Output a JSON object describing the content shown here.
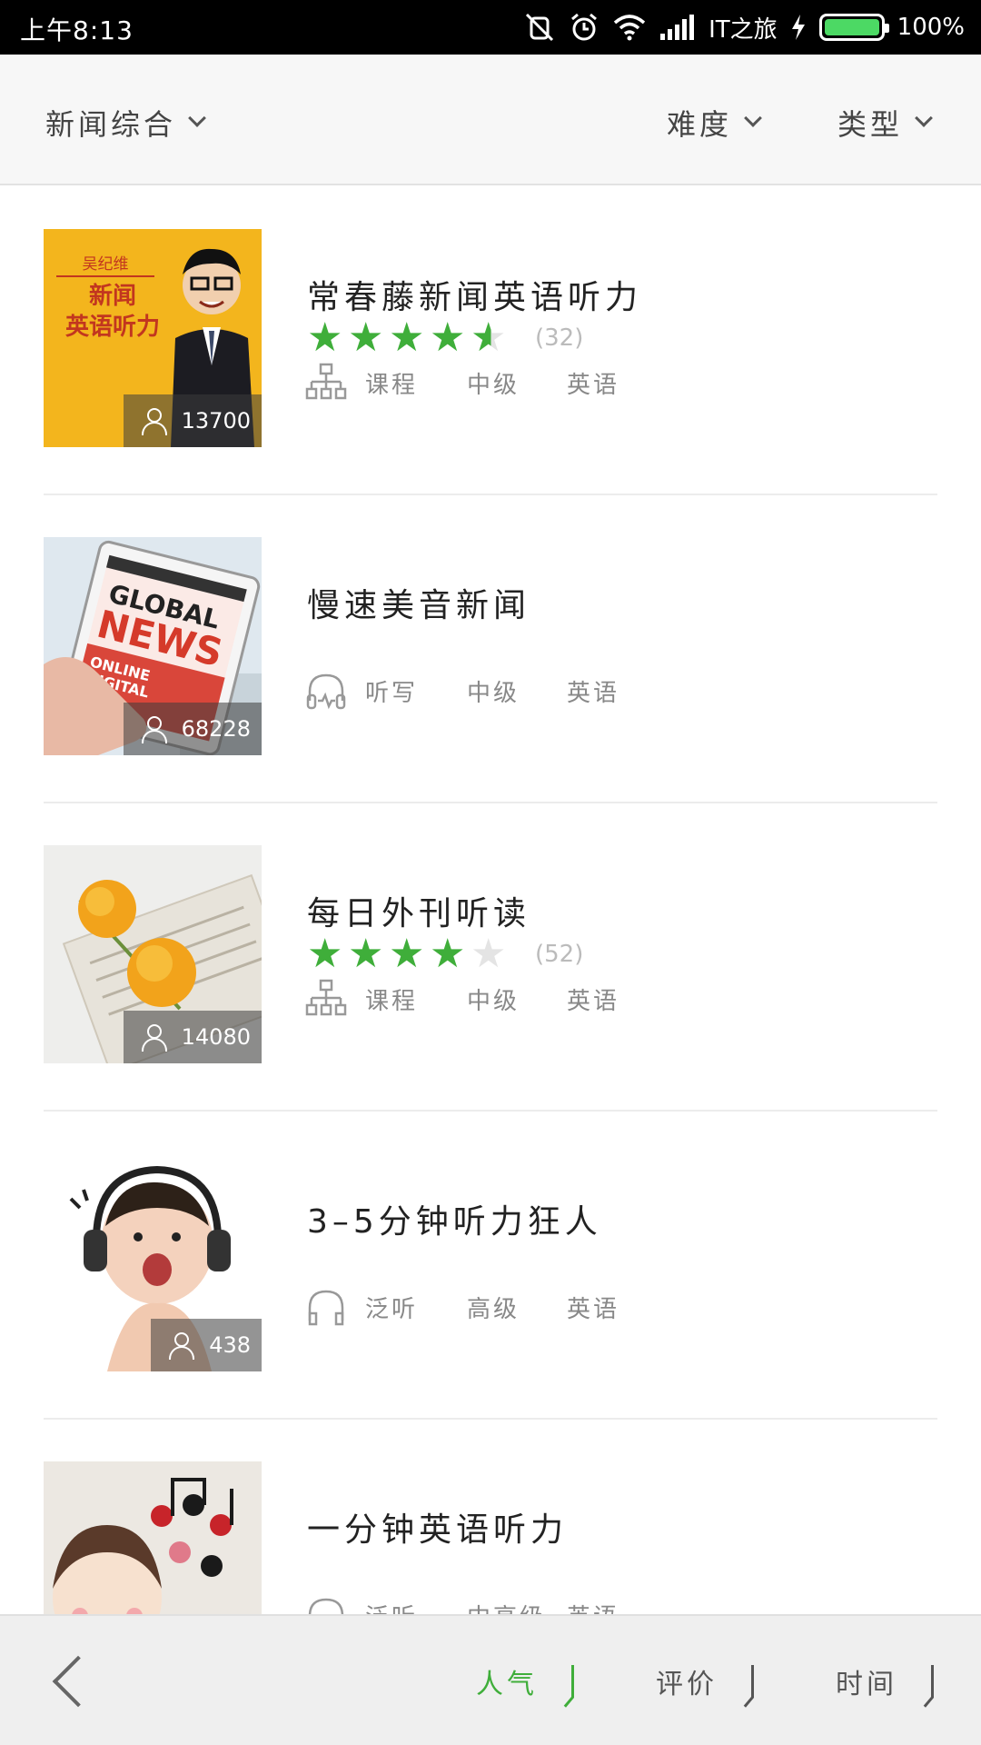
{
  "status_bar": {
    "time": "上午8:13",
    "carrier": "IT之旅",
    "battery": "100%",
    "battery_level": 1.0
  },
  "filters": {
    "category": "新闻综合",
    "difficulty": "难度",
    "type": "类型"
  },
  "items": [
    {
      "title": "常春藤新闻英语听力",
      "rating": 4.5,
      "rating_count": "(32)",
      "type_label": "课程",
      "level": "中级",
      "language": "英语",
      "subscribers": "13700",
      "cover_text_top": "吴纪维",
      "cover_text_main": "新闻\n英语听力",
      "icon": "course-tree-icon"
    },
    {
      "title": "慢速美音新闻",
      "type_label": "听写",
      "level": "中级",
      "language": "英语",
      "subscribers": "68228",
      "cover_text_main": "GLOBAL NEWS",
      "cover_text_sub": "ONLINE DIGITAL",
      "icon": "dictation-headphone-icon"
    },
    {
      "title": "每日外刊听读",
      "rating": 4,
      "rating_count": "(52)",
      "type_label": "课程",
      "level": "中级",
      "language": "英语",
      "subscribers": "14080",
      "icon": "course-tree-icon"
    },
    {
      "title": "3–5分钟听力狂人",
      "type_label": "泛听",
      "level": "高级",
      "language": "英语",
      "subscribers": "438",
      "icon": "headphone-icon"
    },
    {
      "title": "一分钟英语听力",
      "type_label": "泛听",
      "level": "中高级",
      "language": "英语",
      "icon": "headphone-icon"
    }
  ],
  "sort_bar": {
    "popularity": "人气",
    "rating": "评价",
    "time": "时间"
  },
  "colors": {
    "accent": "#3fae3a",
    "star_empty": "#e4e4e4",
    "status_bar_bg": "#000000"
  }
}
